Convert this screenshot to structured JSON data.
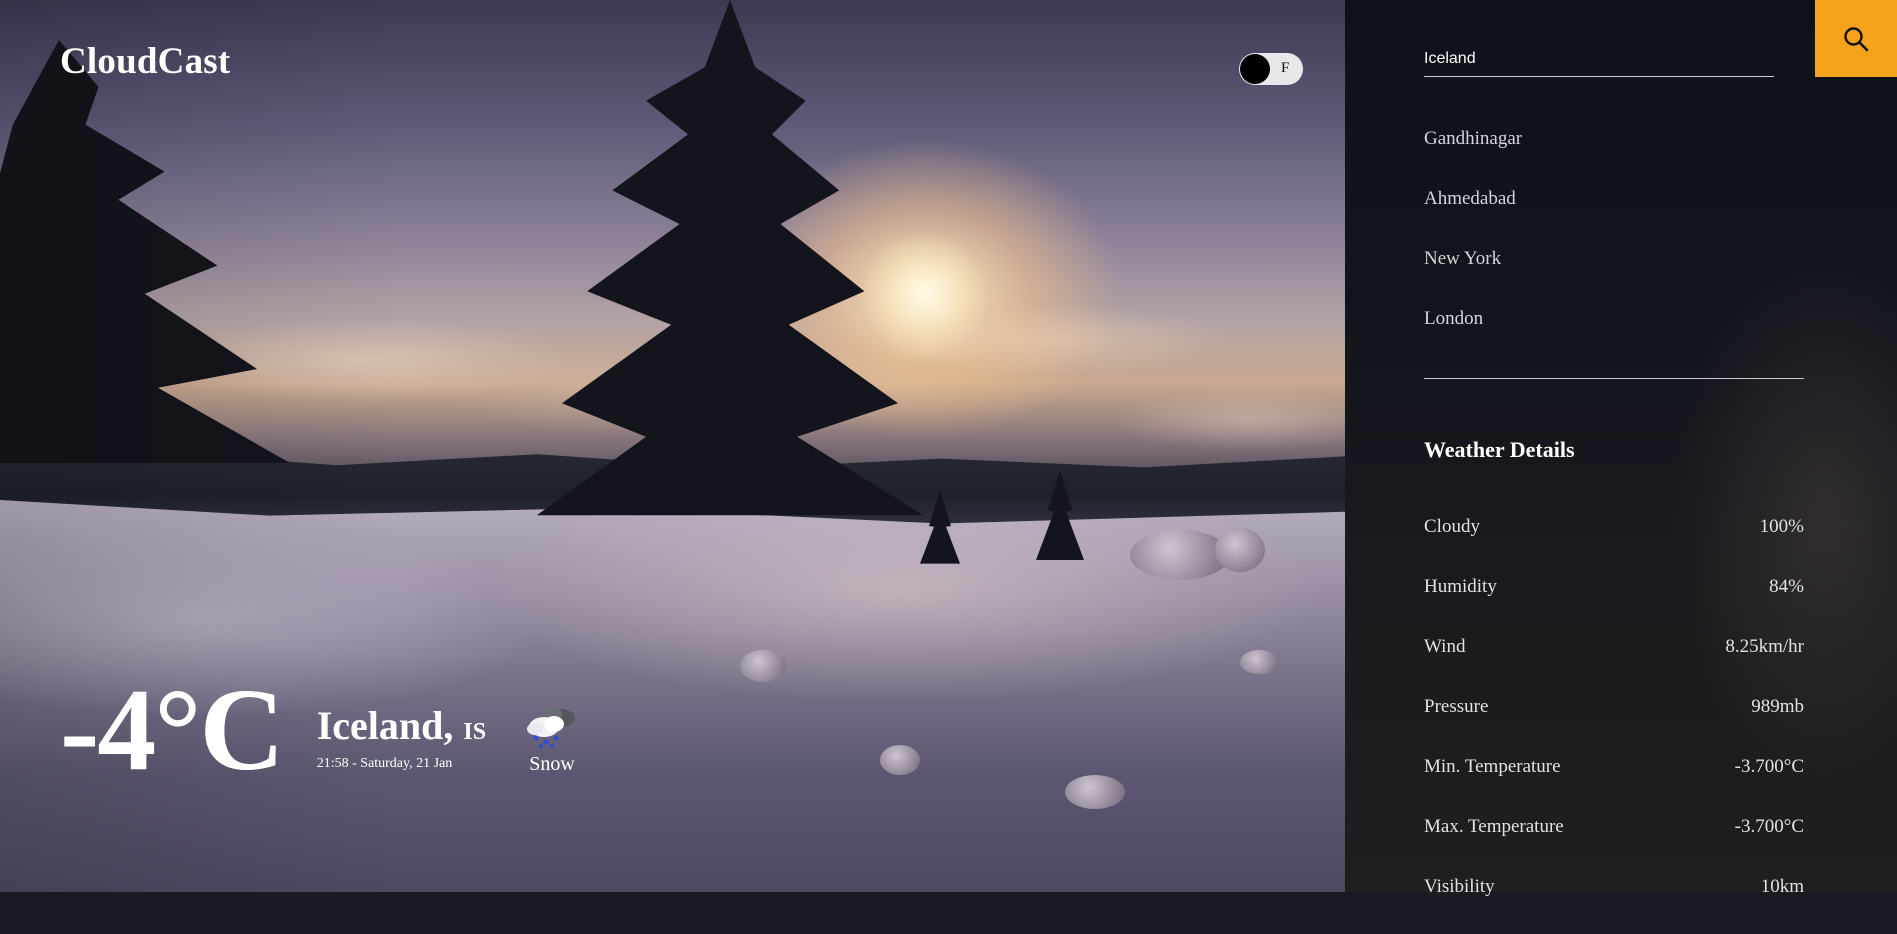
{
  "app": {
    "brand": "CloudCast"
  },
  "unit_toggle": {
    "letter": "F"
  },
  "current": {
    "temperature": "-4°C",
    "city": "Iceland,",
    "country": "IS",
    "datetime": "21:58 - Saturday, 21 Jan",
    "condition": "Snow",
    "condition_icon": "snow-cloud-icon"
  },
  "search": {
    "value": "Iceland",
    "icon": "search-icon"
  },
  "recent_cities": [
    "Gandhinagar",
    "Ahmedabad",
    "New York",
    "London"
  ],
  "details": {
    "title": "Weather Details",
    "rows": [
      {
        "label": "Cloudy",
        "value": "100%"
      },
      {
        "label": "Humidity",
        "value": "84%"
      },
      {
        "label": "Wind",
        "value": "8.25km/hr"
      },
      {
        "label": "Pressure",
        "value": "989mb"
      },
      {
        "label": "Min. Temperature",
        "value": "-3.700°C"
      },
      {
        "label": "Max. Temperature",
        "value": "-3.700°C"
      },
      {
        "label": "Visibility",
        "value": "10km"
      }
    ]
  },
  "colors": {
    "accent": "#f5a31a",
    "panel": "#13151d",
    "toggle_track": "#e8e8ea"
  }
}
